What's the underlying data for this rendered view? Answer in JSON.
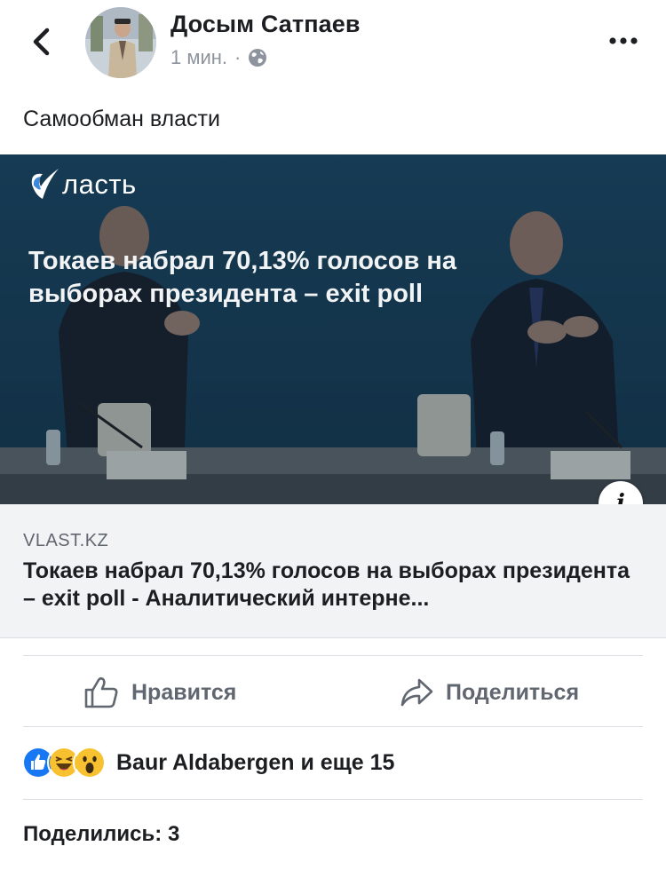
{
  "header": {
    "author": "Досым Сатпаев",
    "time": "1 мин.",
    "separator": "·",
    "icons": {
      "back": "chevron-left-icon",
      "privacy": "globe-icon",
      "more": "more-horizontal-icon"
    }
  },
  "post": {
    "text": "Самообман власти"
  },
  "link_preview": {
    "logo_text": "ласть",
    "image_headline": "Токаев набрал 70,13% голосов на выборах президента – exit poll",
    "domain": "VLAST.KZ",
    "title": "Токаев набрал 70,13% голосов на выборах президента – exit poll - Аналитический интерне...",
    "info_icon": "info-icon",
    "colors": {
      "image_bg": "#1d3f5a",
      "box_bg": "#f2f3f5"
    }
  },
  "actions": {
    "like_label": "Нравится",
    "share_label": "Поделиться"
  },
  "reactions": {
    "icons": [
      "like-reaction-icon",
      "haha-reaction-icon",
      "wow-reaction-icon"
    ],
    "label": "Baur Aldabergen и еще 15"
  },
  "shares": {
    "label": "Поделились: 3"
  }
}
